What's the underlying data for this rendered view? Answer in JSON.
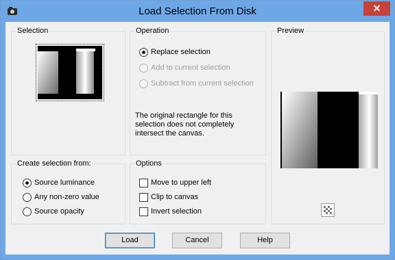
{
  "window": {
    "title": "Load Selection From Disk",
    "close_glyph": "✕"
  },
  "selection": {
    "label": "Selection"
  },
  "operation": {
    "label": "Operation",
    "options": [
      {
        "label": "Replace selection",
        "checked": true,
        "enabled": true
      },
      {
        "label": "Add to current selection",
        "checked": false,
        "enabled": false
      },
      {
        "label": "Subtract from current selection",
        "checked": false,
        "enabled": false
      }
    ],
    "note_lines": [
      "The original rectangle for this",
      "selection does not completely",
      "intersect the canvas."
    ]
  },
  "preview": {
    "label": "Preview",
    "toggle_icon": "checkerboard-icon"
  },
  "create_from": {
    "label": "Create selection from:",
    "options": [
      {
        "label": "Source luminance",
        "checked": true
      },
      {
        "label": "Any non-zero value",
        "checked": false
      },
      {
        "label": "Source opacity",
        "checked": false
      }
    ]
  },
  "options": {
    "label": "Options",
    "items": [
      {
        "label": "Move to upper left",
        "checked": false
      },
      {
        "label": "Clip to canvas",
        "checked": false
      },
      {
        "label": "Invert selection",
        "checked": false
      }
    ]
  },
  "buttons": {
    "load": "Load",
    "cancel": "Cancel",
    "help": "Help"
  },
  "colors": {
    "titlebar": "#6ea7e6",
    "close": "#c7423a",
    "client": "#f0f0f0"
  }
}
